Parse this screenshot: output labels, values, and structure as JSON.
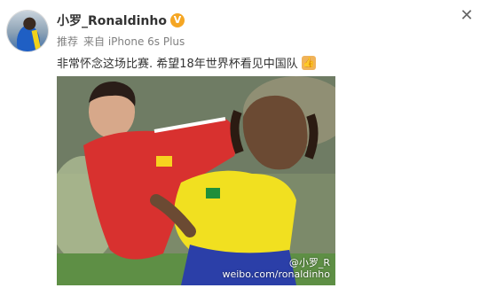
{
  "post": {
    "username": "小罗_Ronaldinho",
    "verified_badge": "V",
    "meta_recommend": "推荐",
    "meta_source": "来自 iPhone 6s Plus",
    "text": "非常怀念这场比赛. 希望18年世界杯看见中国队",
    "emoji_icon": "thumbs-up-icon",
    "close_icon": "close-icon"
  },
  "photo": {
    "watermark_handle": "@小罗_R",
    "watermark_url": "weibo.com/ronaldinho"
  },
  "colors": {
    "verified": "#f5a623",
    "text": "#333333",
    "meta": "#808080",
    "china_red": "#d8312f",
    "brazil_yellow": "#f1e020",
    "brazil_blue": "#2b3fa8"
  }
}
